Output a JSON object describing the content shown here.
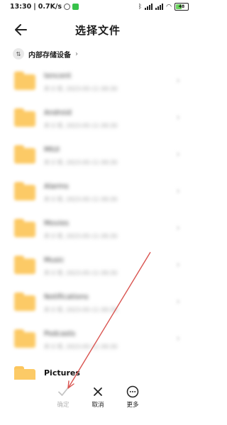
{
  "status_bar": {
    "time": "13:30",
    "speed": "0.7K/s",
    "battery_level": "48"
  },
  "header": {
    "title": "选择文件"
  },
  "breadcrumb": {
    "label": "内部存储设备"
  },
  "list": {
    "items": [
      {
        "name": "tencent",
        "meta": "共 0 项, 2023-05-11 09:30",
        "icon": "folder-icon"
      },
      {
        "name": "Android",
        "meta": "共 0 项, 2023-05-11 09:30",
        "icon": "folder-icon"
      },
      {
        "name": "MIUI",
        "meta": "共 0 项, 2023-05-11 09:30",
        "icon": "folder-icon"
      },
      {
        "name": "Alarms",
        "meta": "共 0 项, 2023-05-11 09:30",
        "icon": "folder-icon"
      },
      {
        "name": "Movies",
        "meta": "共 0 项, 2023-05-11 09:30",
        "icon": "folder-icon"
      },
      {
        "name": "Music",
        "meta": "共 0 项, 2023-05-11 09:30",
        "icon": "folder-icon"
      },
      {
        "name": "Notifications",
        "meta": "共 0 项, 2023-05-11 09:30",
        "icon": "folder-icon"
      },
      {
        "name": "Podcasts",
        "meta": "共 0 项, 2023-05-11 09:30",
        "icon": "folder-icon"
      },
      {
        "name": "Pictures",
        "meta": "",
        "icon": "folder-icon"
      }
    ]
  },
  "bottom_bar": {
    "confirm_label": "确定",
    "cancel_label": "取消",
    "more_label": "更多"
  },
  "colors": {
    "folder": "#fcca66",
    "annotation_arrow": "#d9534f",
    "battery_fill": "#6bd35d"
  }
}
